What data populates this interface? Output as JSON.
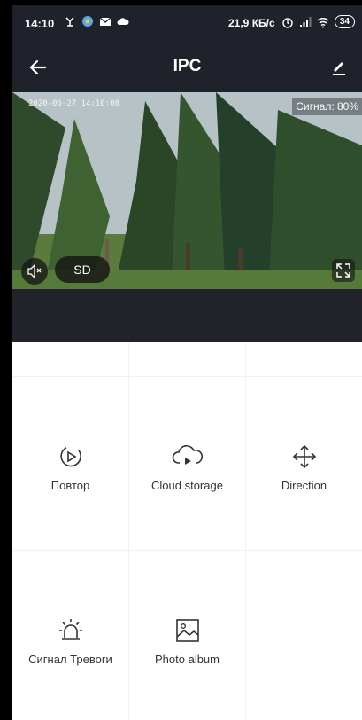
{
  "status_bar": {
    "time": "14:10",
    "speed": "21,9 КБ/с",
    "battery": "34",
    "icons_left": [
      "usb-debug-icon",
      "app-icon",
      "mail-icon",
      "cloud-icon"
    ],
    "icons_right": [
      "alarm-icon",
      "cell-signal-icon",
      "wifi-icon"
    ]
  },
  "header": {
    "title": "IPC",
    "back_icon": "arrow-left-icon",
    "edit_icon": "pencil-icon"
  },
  "video": {
    "timestamp": "2020-06-27 14:10:08",
    "signal": "Сигнал: 80%",
    "quality_button": "SD",
    "mute_icon": "speaker-muted-icon",
    "fullscreen_icon": "fullscreen-icon"
  },
  "functions": [
    {
      "label": "Повтор",
      "icon": "playback-icon"
    },
    {
      "label": "Cloud storage",
      "icon": "cloud-play-icon"
    },
    {
      "label": "Direction",
      "icon": "move-arrows-icon"
    },
    {
      "label": "Сигнал Тревоги",
      "icon": "siren-icon"
    },
    {
      "label": "Photo album",
      "icon": "image-icon"
    }
  ],
  "colors": {
    "header_bg": "#1f222b",
    "band_bg": "#202329",
    "text": "#333333"
  }
}
